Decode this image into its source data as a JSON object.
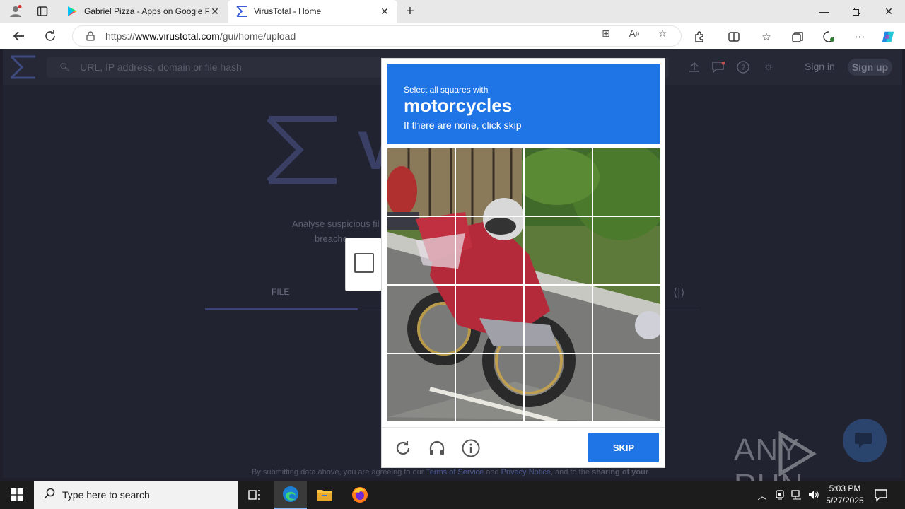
{
  "browser": {
    "tabs": [
      {
        "title": "Gabriel Pizza - Apps on Google Play",
        "active": false
      },
      {
        "title": "VirusTotal - Home",
        "active": true
      }
    ],
    "url_prefix": "https://",
    "url_host": "www.virustotal.com",
    "url_path": "/gui/home/upload"
  },
  "vt": {
    "search_placeholder": "URL, IP address, domain or file hash",
    "sign_in": "Sign in",
    "sign_up": "Sign up",
    "big_text": "V",
    "desc_line1": "Analyse suspicious fil",
    "desc_line2": "breache",
    "tab_file": "FILE",
    "footer_prefix": "By submitting data above, you are agreeing to our ",
    "footer_tos": "Terms of Service",
    "footer_and": " and ",
    "footer_privacy": "Privacy Notice",
    "footer_rest": ", and to the ",
    "footer_bold": "sharing of your"
  },
  "captcha": {
    "line1": "Select all squares with",
    "target": "motorcycles",
    "line3": "If there are none, click skip",
    "skip_label": "SKIP",
    "grid": {
      "rows": 4,
      "cols": 4
    }
  },
  "watermark": {
    "text": "ANY RUN"
  },
  "taskbar": {
    "search_placeholder": "Type here to search",
    "time": "5:03 PM",
    "date": "5/27/2025"
  },
  "colors": {
    "captcha_blue": "#1f74e6",
    "vt_bg": "#222330",
    "vt_header": "#262836"
  }
}
